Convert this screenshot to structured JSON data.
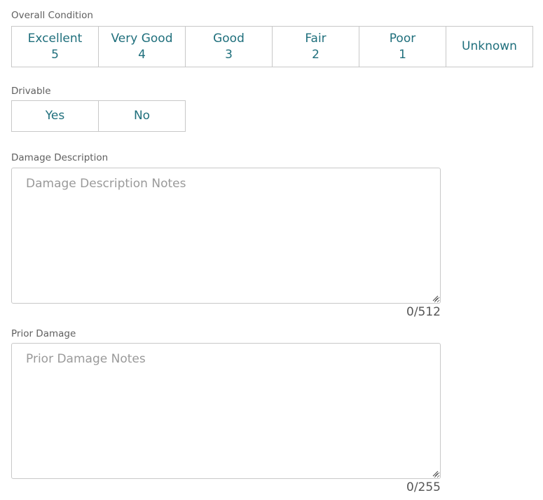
{
  "overall_condition": {
    "label": "Overall Condition",
    "options": [
      {
        "name": "Excellent",
        "value": "5"
      },
      {
        "name": "Very Good",
        "value": "4"
      },
      {
        "name": "Good",
        "value": "3"
      },
      {
        "name": "Fair",
        "value": "2"
      },
      {
        "name": "Poor",
        "value": "1"
      },
      {
        "name": "Unknown",
        "value": ""
      }
    ]
  },
  "drivable": {
    "label": "Drivable",
    "options": [
      {
        "name": "Yes"
      },
      {
        "name": "No"
      }
    ]
  },
  "damage_description": {
    "label": "Damage Description",
    "placeholder": "Damage Description Notes",
    "counter": "0/512"
  },
  "prior_damage": {
    "label": "Prior Damage",
    "placeholder": "Prior Damage Notes",
    "counter": "0/255"
  },
  "colors": {
    "accent": "#1f6f7c",
    "border": "#c8c8c8",
    "label": "#606060"
  }
}
